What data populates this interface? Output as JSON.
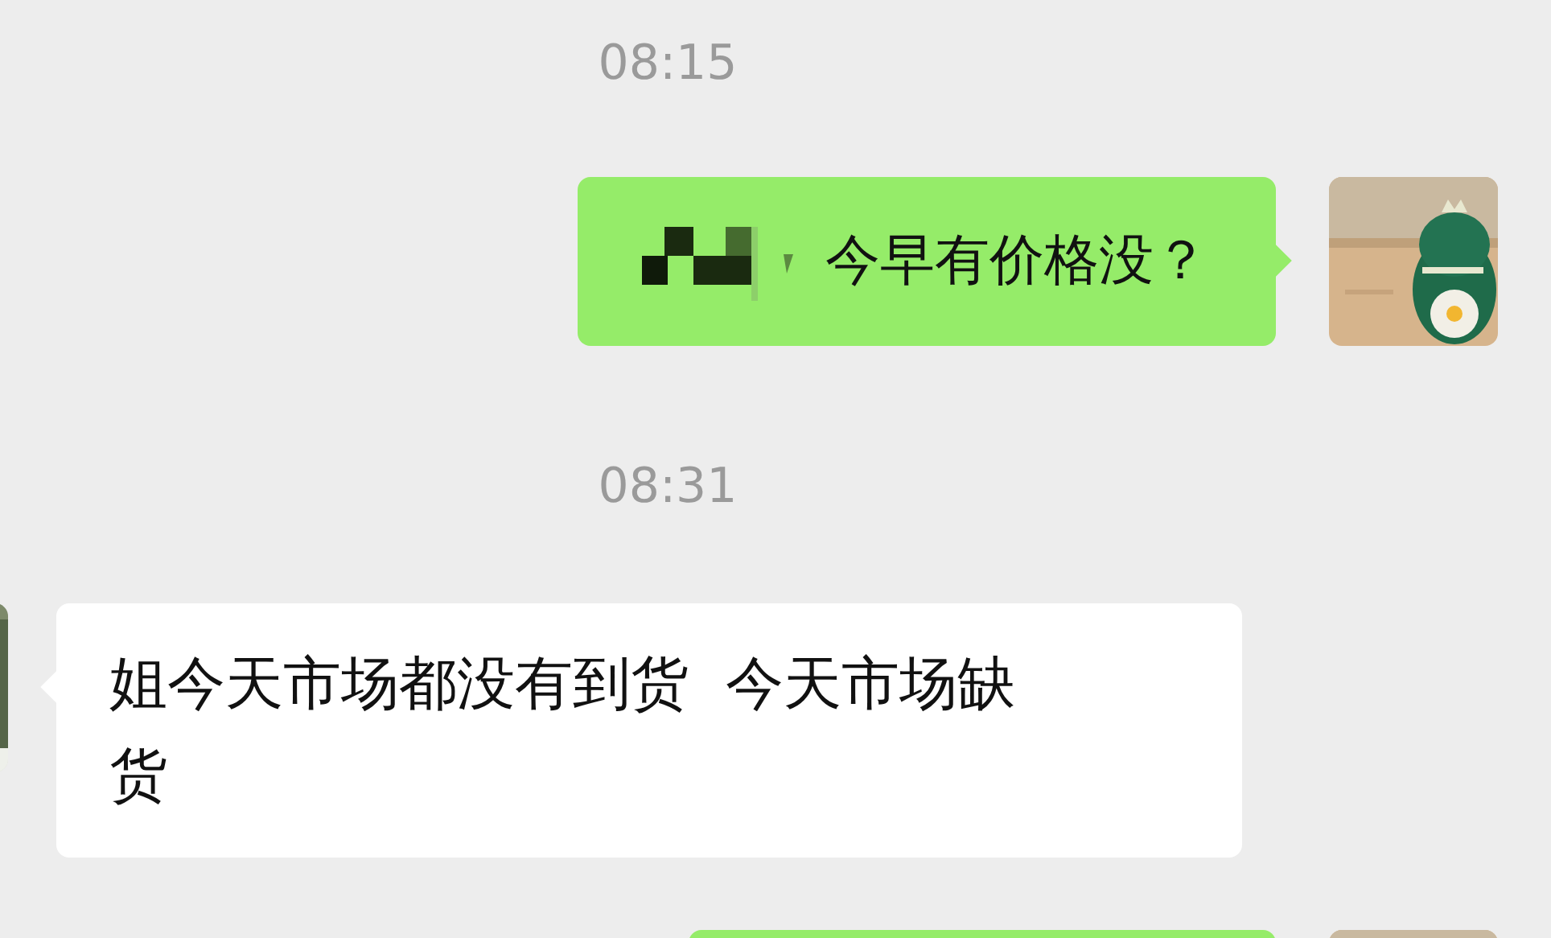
{
  "messages": [
    {
      "kind": "timestamp",
      "text": "08:15"
    },
    {
      "kind": "sent_message",
      "redacted_prefix": true,
      "text": "今早有价格没？"
    },
    {
      "kind": "timestamp",
      "text": "08:31"
    },
    {
      "kind": "received_message",
      "redacted_prefix": false,
      "text": "姐今天市场都没有到货  今天市场缺货"
    },
    {
      "kind": "sent_message",
      "redacted_prefix": false
    }
  ]
}
